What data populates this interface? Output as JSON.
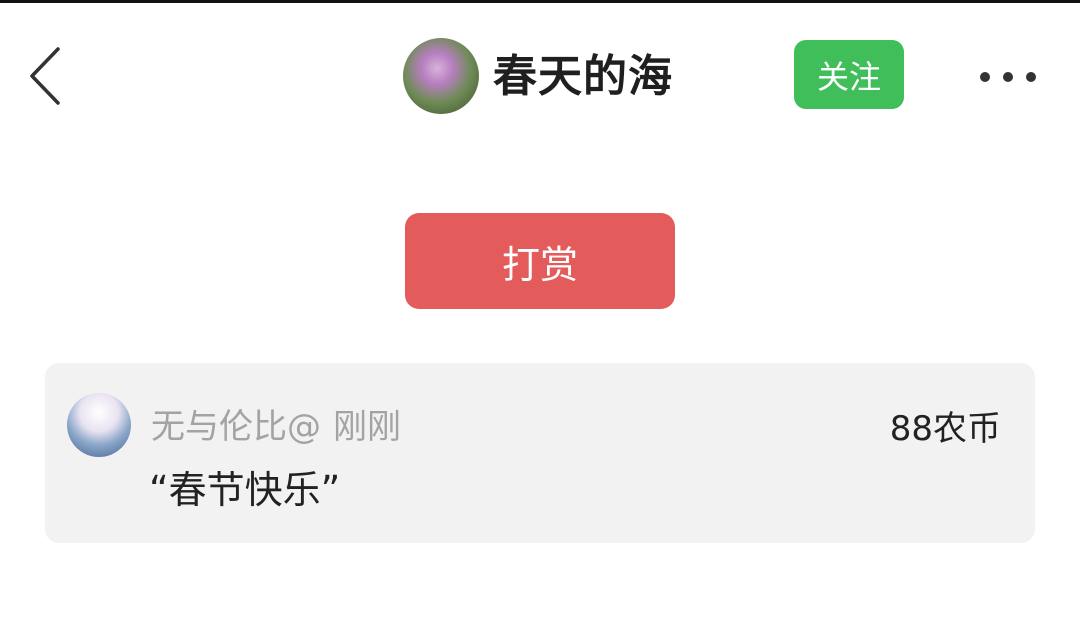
{
  "header": {
    "author_name": "春天的海",
    "follow_label": "关注",
    "back_icon": "chevron-left-icon",
    "more_icon": "more-horizontal-icon"
  },
  "actions": {
    "tip_label": "打赏"
  },
  "tip_record": {
    "user": "无与伦比@",
    "time": "刚刚",
    "amount": "88农币",
    "message": "“春节快乐”"
  },
  "colors": {
    "follow_green": "#3fbe5a",
    "tip_red": "#e35b5b",
    "card_bg": "#f2f2f2"
  }
}
